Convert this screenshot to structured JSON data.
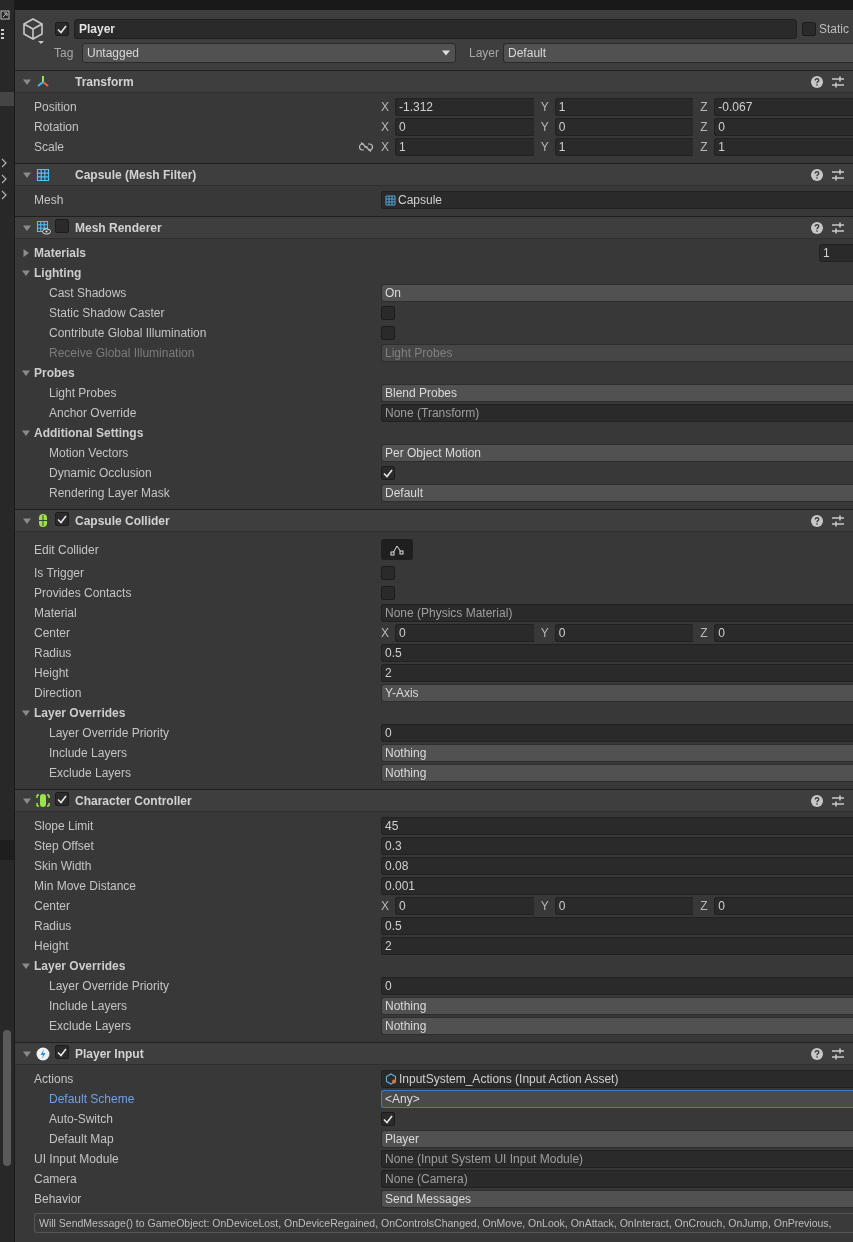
{
  "game_object": {
    "active": true,
    "name": "Player",
    "static": false,
    "static_label": "Static",
    "tag_label": "Tag",
    "tag": "Untagged",
    "layer_label": "Layer",
    "layer": "Default"
  },
  "components": [
    {
      "kind": "transform",
      "title": "Transform",
      "expanded": true,
      "rows": [
        {
          "kind": "vector3",
          "label": "Position",
          "values": [
            {
              "axis": "X",
              "value": "-1.312"
            },
            {
              "axis": "Y",
              "value": "1"
            },
            {
              "axis": "Z",
              "value": "-0.067"
            }
          ]
        },
        {
          "kind": "vector3",
          "label": "Rotation",
          "values": [
            {
              "axis": "X",
              "value": "0"
            },
            {
              "axis": "Y",
              "value": "0"
            },
            {
              "axis": "Z",
              "value": "0"
            }
          ]
        },
        {
          "kind": "vector3",
          "label": "Scale",
          "constrain_proportions": false,
          "values": [
            {
              "axis": "X",
              "value": "1"
            },
            {
              "axis": "Y",
              "value": "1"
            },
            {
              "axis": "Z",
              "value": "1"
            }
          ]
        }
      ]
    },
    {
      "kind": "mesh_filter",
      "title": "Capsule (Mesh Filter)",
      "expanded": true,
      "rows": [
        {
          "kind": "mesh_asset",
          "label": "Mesh",
          "value": "Capsule"
        }
      ]
    },
    {
      "kind": "mesh_renderer",
      "title": "Mesh Renderer",
      "enabled": false,
      "expanded": true,
      "rows": [
        {
          "kind": "foldout",
          "label": "Materials",
          "expanded": false,
          "count": "1"
        },
        {
          "kind": "foldout",
          "label": "Lighting",
          "expanded": true,
          "children": [
            {
              "kind": "dropdown",
              "label": "Cast Shadows",
              "value": "On",
              "disabled": false
            },
            {
              "kind": "checkbox",
              "label": "Static Shadow Caster",
              "checked": false,
              "disabled": false
            },
            {
              "kind": "checkbox",
              "label": "Contribute Global Illumination",
              "checked": false,
              "disabled": false
            },
            {
              "kind": "dropdown",
              "label": "Receive Global Illumination",
              "value": "Light Probes",
              "disabled": true
            }
          ]
        },
        {
          "kind": "foldout",
          "label": "Probes",
          "expanded": true,
          "children": [
            {
              "kind": "dropdown",
              "label": "Light Probes",
              "value": "Blend Probes"
            },
            {
              "kind": "object",
              "label": "Anchor Override",
              "value": "None (Transform)"
            }
          ]
        },
        {
          "kind": "foldout",
          "label": "Additional Settings",
          "expanded": true,
          "children": [
            {
              "kind": "dropdown",
              "label": "Motion Vectors",
              "value": "Per Object Motion"
            },
            {
              "kind": "checkbox",
              "label": "Dynamic Occlusion",
              "checked": true
            },
            {
              "kind": "dropdown",
              "label": "Rendering Layer Mask",
              "value": "Default"
            }
          ]
        }
      ]
    },
    {
      "kind": "capsule_collider",
      "title": "Capsule Collider",
      "enabled": true,
      "expanded": true,
      "rows": [
        {
          "kind": "edit_button",
          "label": "Edit Collider"
        },
        {
          "kind": "checkbox",
          "label": "Is Trigger",
          "checked": false
        },
        {
          "kind": "checkbox",
          "label": "Provides Contacts",
          "checked": false
        },
        {
          "kind": "object",
          "label": "Material",
          "value": "None (Physics Material)"
        },
        {
          "kind": "vector3",
          "label": "Center",
          "values": [
            {
              "axis": "X",
              "value": "0"
            },
            {
              "axis": "Y",
              "value": "0"
            },
            {
              "axis": "Z",
              "value": "0"
            }
          ]
        },
        {
          "kind": "number",
          "label": "Radius",
          "value": "0.5"
        },
        {
          "kind": "number",
          "label": "Height",
          "value": "2"
        },
        {
          "kind": "dropdown",
          "label": "Direction",
          "value": "Y-Axis"
        },
        {
          "kind": "foldout",
          "label": "Layer Overrides",
          "expanded": true,
          "children": [
            {
              "kind": "number",
              "label": "Layer Override Priority",
              "value": "0"
            },
            {
              "kind": "dropdown",
              "label": "Include Layers",
              "value": "Nothing"
            },
            {
              "kind": "dropdown",
              "label": "Exclude Layers",
              "value": "Nothing"
            }
          ]
        }
      ]
    },
    {
      "kind": "character_controller",
      "title": "Character Controller",
      "enabled": true,
      "expanded": true,
      "rows": [
        {
          "kind": "number",
          "label": "Slope Limit",
          "value": "45"
        },
        {
          "kind": "number",
          "label": "Step Offset",
          "value": "0.3"
        },
        {
          "kind": "number",
          "label": "Skin Width",
          "value": "0.08"
        },
        {
          "kind": "number",
          "label": "Min Move Distance",
          "value": "0.001"
        },
        {
          "kind": "vector3",
          "label": "Center",
          "values": [
            {
              "axis": "X",
              "value": "0"
            },
            {
              "axis": "Y",
              "value": "0"
            },
            {
              "axis": "Z",
              "value": "0"
            }
          ]
        },
        {
          "kind": "number",
          "label": "Radius",
          "value": "0.5"
        },
        {
          "kind": "number",
          "label": "Height",
          "value": "2"
        },
        {
          "kind": "foldout",
          "label": "Layer Overrides",
          "expanded": true,
          "children": [
            {
              "kind": "number",
              "label": "Layer Override Priority",
              "value": "0"
            },
            {
              "kind": "dropdown",
              "label": "Include Layers",
              "value": "Nothing"
            },
            {
              "kind": "dropdown",
              "label": "Exclude Layers",
              "value": "Nothing"
            }
          ]
        }
      ]
    },
    {
      "kind": "player_input",
      "title": "Player Input",
      "enabled": true,
      "expanded": true,
      "rows": [
        {
          "kind": "input_asset",
          "label": "Actions",
          "value": "InputSystem_Actions (Input Action Asset)",
          "children": [
            {
              "kind": "dropdown",
              "label": "Default Scheme",
              "value": "<Any>",
              "focused": true
            },
            {
              "kind": "checkbox",
              "label": "Auto-Switch",
              "checked": true,
              "focused": false
            },
            {
              "kind": "dropdown",
              "label": "Default Map",
              "value": "Player",
              "focused": false
            }
          ]
        },
        {
          "kind": "object",
          "label": "UI Input Module",
          "value": "None (Input System UI Input Module)"
        },
        {
          "kind": "object",
          "label": "Camera",
          "value": "None (Camera)"
        },
        {
          "kind": "dropdown",
          "label": "Behavior",
          "value": "Send Messages"
        }
      ],
      "help": "Will SendMessage() to GameObject: OnDeviceLost, OnDeviceRegained, OnControlsChanged, OnMove, OnLook, OnAttack, OnInteract, OnCrouch, OnJump, OnPrevious,"
    }
  ]
}
